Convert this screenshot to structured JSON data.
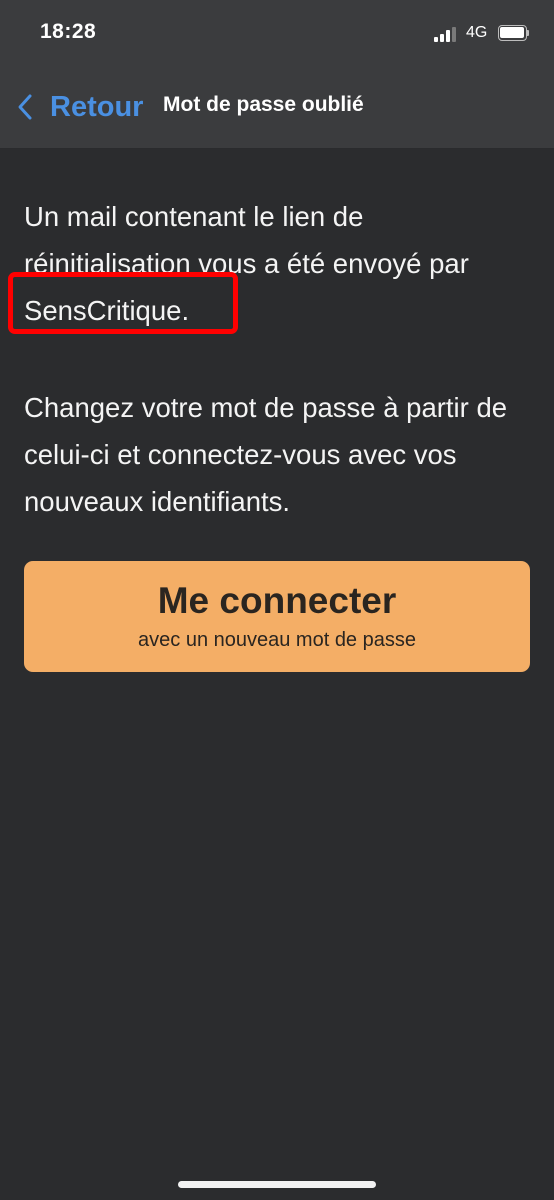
{
  "status_bar": {
    "time": "18:28",
    "network": "4G",
    "signal_bars_active": 3,
    "signal_bars_total": 4,
    "battery_level": 1.0
  },
  "nav": {
    "back_label": "Retour",
    "back_icon": "chevron-left-icon",
    "title": "Mot de passe oublié"
  },
  "content": {
    "message_1": "Un mail contenant le lien de réinitialisation vous a été envoyé par SensCritique.",
    "message_2": "Changez votre mot de passe à partir de celui-ci et connectez-vous avec vos nouveaux identifiants."
  },
  "connect_button": {
    "label": "Me connecter",
    "sublabel": "avec un nouveau mot de passe"
  },
  "colors": {
    "background": "#2b2c2e",
    "header": "#3b3c3e",
    "accent_blue": "#4a90e2",
    "button_orange": "#f4ae66",
    "annotation_red": "#ff0000",
    "signal_inactive": "#7a7a7a"
  }
}
